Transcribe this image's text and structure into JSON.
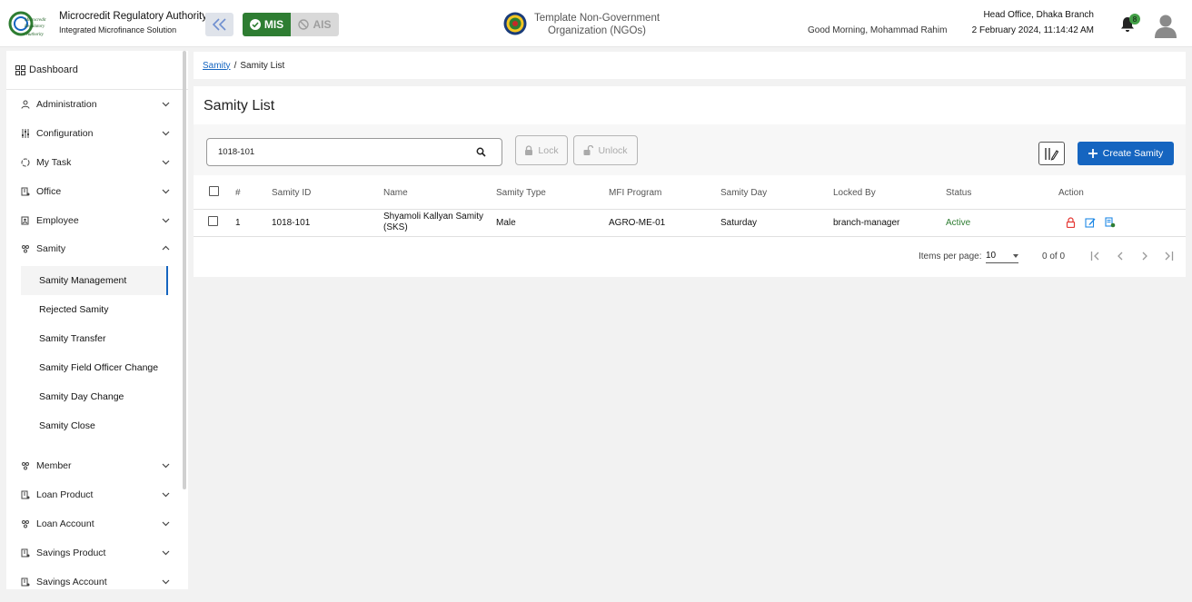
{
  "header": {
    "org_name": "Microcredit Regulatory Authority",
    "org_sub": "Integrated Microfinance Solution",
    "logo_lines": [
      "Microcredit",
      "Regulatory",
      "Authority"
    ],
    "mis_label": "MIS",
    "ais_label": "AIS",
    "ngo_line1": "Template Non-Government",
    "ngo_line2": "Organization (NGOs)",
    "greeting": "Good Morning, Mohammad Rahim",
    "branch": "Head Office, Dhaka Branch",
    "datetime": "2 February 2024, 11:14:42 AM",
    "notification_count": "8",
    "accent": "#2e7d32"
  },
  "sidebar": {
    "dashboard": "Dashboard",
    "items": [
      {
        "label": "Administration",
        "icon": "admin-icon"
      },
      {
        "label": "Configuration",
        "icon": "config-icon"
      },
      {
        "label": "My Task",
        "icon": "task-icon"
      },
      {
        "label": "Office",
        "icon": "office-icon"
      },
      {
        "label": "Employee",
        "icon": "employee-icon"
      },
      {
        "label": "Samity",
        "icon": "samity-icon"
      },
      {
        "label": "Member",
        "icon": "member-icon"
      },
      {
        "label": "Loan Product",
        "icon": "loan-product-icon"
      },
      {
        "label": "Loan Account",
        "icon": "loan-account-icon"
      },
      {
        "label": "Savings Product",
        "icon": "savings-product-icon"
      },
      {
        "label": "Savings Account",
        "icon": "savings-account-icon"
      }
    ],
    "samity_sub": [
      "Samity Management",
      "Rejected Samity",
      "Samity Transfer",
      "Samity Field Officer Change",
      "Samity Day Change",
      "Samity Close"
    ]
  },
  "breadcrumb": {
    "link": "Samity",
    "separator": "/",
    "current": "Samity List"
  },
  "page": {
    "title": "Samity List",
    "search_value": "1018-101",
    "lock_label": "Lock",
    "unlock_label": "Unlock",
    "create_label": "Create Samity",
    "primary_color": "#1565c0"
  },
  "table": {
    "columns": [
      "#",
      "Samity ID",
      "Name",
      "Samity Type",
      "MFI Program",
      "Samity Day",
      "Locked By",
      "Status",
      "Action"
    ],
    "rows": [
      {
        "index": "1",
        "samity_id": "1018-101",
        "name": "Shyamoli Kallyan Samity (SKS)",
        "type": "Male",
        "program": "AGRO-ME-01",
        "day": "Saturday",
        "locked_by": "branch-manager",
        "status": "Active"
      }
    ]
  },
  "pager": {
    "items_per_page_label": "Items per page:",
    "items_per_page": "10",
    "range": "0 of 0"
  }
}
